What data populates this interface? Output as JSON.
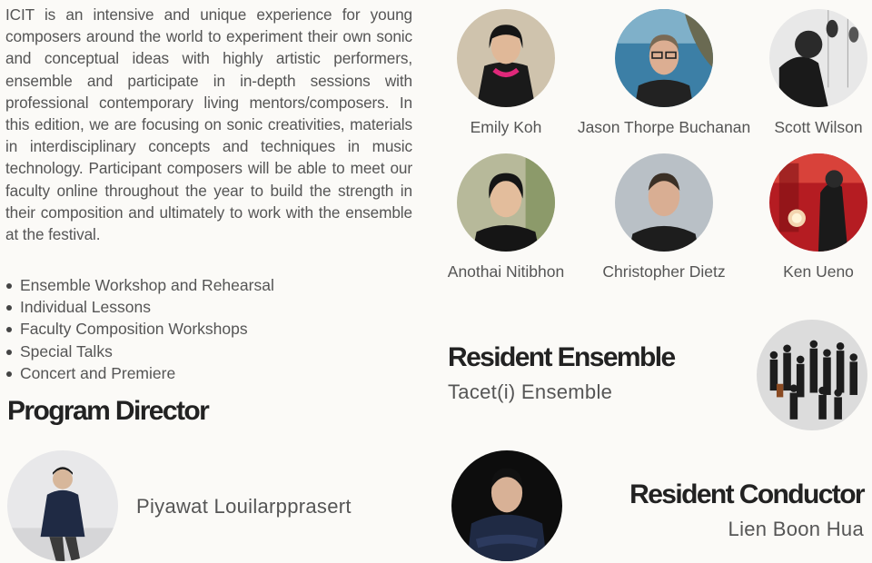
{
  "intro": {
    "paragraph": "ICIT is an intensive and unique experience for young composers around the world to experiment their own sonic and conceptual ideas with highly artistic performers, ensemble and participate in in-depth sessions with professional contemporary living mentors/composers. In this edition, we are focusing on sonic creativities, materials in interdisciplinary concepts and techniques in music technology. Participant composers will be able to meet our faculty online throughout the year to build the strength in their composition and ultimately to work with the ensemble at the festival."
  },
  "features": [
    "Ensemble Workshop and Rehearsal",
    "Individual Lessons",
    "Faculty Composition Workshops",
    "Special Talks",
    "Concert and Premiere"
  ],
  "program_director": {
    "heading": "Program Director",
    "name": "Piyawat  Louilarpprasert"
  },
  "faculty": [
    {
      "name": "Emily Koh"
    },
    {
      "name": "Jason Thorpe Buchanan"
    },
    {
      "name": "Scott Wilson"
    },
    {
      "name": "Anothai Nitibhon"
    },
    {
      "name": "Christopher Dietz"
    },
    {
      "name": "Ken Ueno"
    }
  ],
  "resident_ensemble": {
    "heading": "Resident Ensemble",
    "name": "Tacet(i) Ensemble"
  },
  "resident_conductor": {
    "heading": "Resident Conductor",
    "name": "Lien Boon Hua"
  },
  "colors": {
    "background": "#fbfaf7",
    "heading": "#222222",
    "body_text": "#555555"
  }
}
